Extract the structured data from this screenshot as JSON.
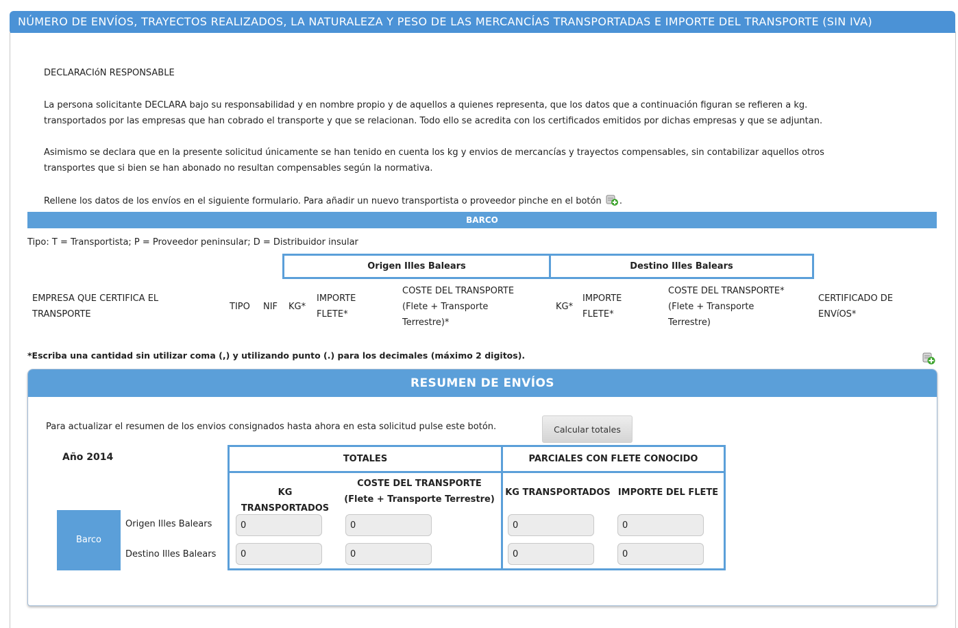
{
  "header": {
    "title": "NÚMERO DE ENVÍOS, TRAYECTOS REALIZADOS, LA NATURALEZA Y PESO DE LAS MERCANCÍAS TRANSPORTADAS E IMPORTE DEL TRANSPORTE (SIN IVA)"
  },
  "intro": {
    "heading": "DECLARACIóN RESPONSABLE",
    "p1_line1": "La persona solicitante DECLARA bajo su responsabilidad y en nombre propio y de aquellos a quienes representa, que los datos que a continuación figuran se refieren a kg.",
    "p1_line2": "transportados por las empresas que han cobrado el transporte y que se relacionan. Todo ello se acredita con los certificados emitidos por dichas empresas y que se adjuntan.",
    "p2_line1": "Asimismo se declara que en la presente solicitud únicamente se han tenido en cuenta los kg y envios de mercancías y trayectos compensables, sin contabilizar aquellos otros",
    "p2_line2": "transportes que si bien se han abonado no resultan compensables según la normativa.",
    "p3": "Rellene los datos de los envíos en el siguiente formulario. Para añadir un nuevo transportista o proveedor pinche en el botón",
    "p3_end": "."
  },
  "section": {
    "title": "BARCO",
    "tipo_legend": "Tipo: T = Transportista; P = Proveedor peninsular; D = Distribuidor insular",
    "origen": "Origen Illes Balears",
    "destino": "Destino Illes Balears",
    "columns": {
      "empresa_l1": "EMPRESA QUE CERTIFICA EL",
      "empresa_l2": "TRANSPORTE",
      "tipo": "TIPO",
      "nif": "NIF",
      "kg1": "KG*",
      "importe1_l1": "IMPORTE",
      "importe1_l2": "FLETE*",
      "coste1_l1": "COSTE DEL TRANSPORTE",
      "coste1_l2": "(Flete + Transporte",
      "coste1_l3": "Terrestre)*",
      "kg2": "KG*",
      "importe2_l1": "IMPORTE",
      "importe2_l2": "FLETE*",
      "coste2_l1": "COSTE DEL TRANSPORTE*",
      "coste2_l2": "(Flete + Transporte",
      "coste2_l3": "Terrestre)",
      "cert_l1": "CERTIFICADO DE",
      "cert_l2": "ENVíOS*"
    },
    "note": "*Escriba una cantidad sin utilizar coma (,) y utilizando punto (.) para los decimales (máximo 2 digitos)."
  },
  "resumen": {
    "title": "RESUMEN DE ENVÍOS",
    "calc_text": "Para actualizar el resumen de los envios consignados hasta ahora en esta solicitud pulse este botón.",
    "calc_button": "Calcular totales",
    "year": "Año 2014",
    "totales": "TOTALES",
    "parciales": "PARCIALES CON FLETE CONOCIDO",
    "kg_transportados": "KG TRANSPORTADOS",
    "coste_l1": "COSTE DEL TRANSPORTE",
    "coste_l2": "(Flete + Transporte Terrestre)",
    "kg_transportados2": "KG TRANSPORTADOS",
    "importe_flete": "IMPORTE DEL FLETE",
    "mode": "Barco",
    "rows": [
      {
        "label": "Origen Illes Balears",
        "values": [
          "0",
          "0",
          "0",
          "0"
        ]
      },
      {
        "label": "Destino Illes Balears",
        "values": [
          "0",
          "0",
          "0",
          "0"
        ]
      }
    ]
  },
  "colors": {
    "accent": "#5b9fd9",
    "header": "#4b92d6"
  }
}
